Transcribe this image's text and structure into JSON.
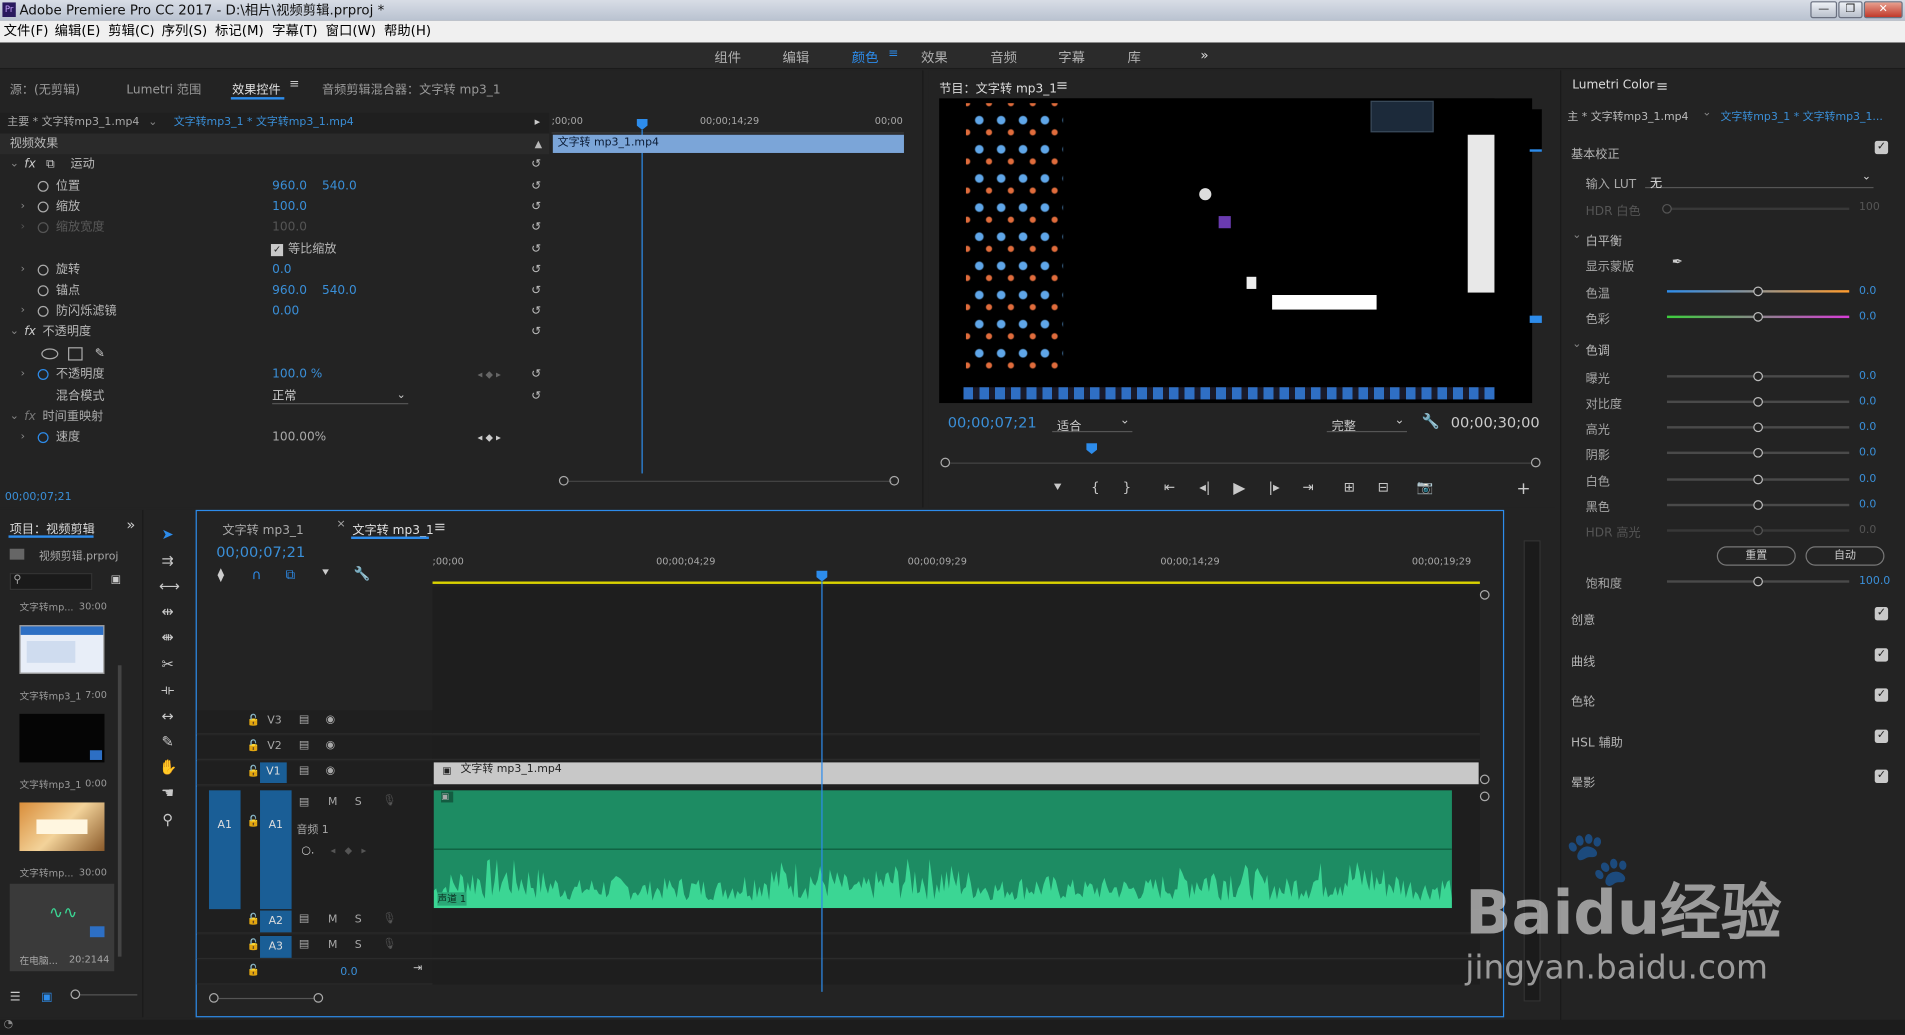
{
  "app": {
    "title": "Adobe Premiere Pro CC 2017 - D:\\相片\\视频剪辑.prproj *",
    "logo": "Pr"
  },
  "window_buttons": {
    "minimize": "—",
    "restore": "❐",
    "close": "✕"
  },
  "menu": [
    "文件(F)",
    "编辑(E)",
    "剪辑(C)",
    "序列(S)",
    "标记(M)",
    "字幕(T)",
    "窗口(W)",
    "帮助(H)"
  ],
  "workspaces": {
    "items": [
      "组件",
      "编辑",
      "颜色",
      "效果",
      "音频",
      "字幕",
      "库"
    ],
    "active": "颜色",
    "more": "»"
  },
  "source_panel": {
    "tabs": [
      "源：(无剪辑)",
      "Lumetri 范围",
      "效果控件",
      "音频剪辑混合器：文字转 mp3_1"
    ],
    "active_tab": "效果控件",
    "master_clip": "主要 * 文字转mp3_1.mp4",
    "sequence_clip": "文字转mp3_1 * 文字转mp3_1.mp4",
    "ruler": {
      "start": ";00;00",
      "mid": "00;00;14;29",
      "end": "00;00"
    },
    "clip_bar": "文字转 mp3_1.mp4",
    "video_effects": "视频效果",
    "motion": "运动",
    "position": {
      "label": "位置",
      "x": "960.0",
      "y": "540.0"
    },
    "scale": {
      "label": "缩放",
      "value": "100.0"
    },
    "scale_width": {
      "label": "缩放宽度",
      "value": "100.0"
    },
    "uniform": {
      "label": "等比缩放",
      "checked": true
    },
    "rotation": {
      "label": "旋转",
      "value": "0.0"
    },
    "anchor": {
      "label": "锚点",
      "x": "960.0",
      "y": "540.0"
    },
    "antiflicker": {
      "label": "防闪烁滤镜",
      "value": "0.00"
    },
    "opacity_group": "不透明度",
    "opacity": {
      "label": "不透明度",
      "value": "100.0 %"
    },
    "blend": {
      "label": "混合模式",
      "value": "正常"
    },
    "time_remap": "时间重映射",
    "speed": {
      "label": "速度",
      "value": "100.00%"
    },
    "timecode": "00;00;07;21"
  },
  "program": {
    "tab": "节目：文字转 mp3_1",
    "timecode": "00;00;07;21",
    "fit": "适合",
    "quality": "完整",
    "duration": "00;00;30;00"
  },
  "lumetri": {
    "tab": "Lumetri Color",
    "master": "主 * 文字转mp3_1.mp4",
    "clip": "文字转mp3_1 * 文字转mp3_1...",
    "basic": "基本校正",
    "input_lut": "输入 LUT",
    "lut_value": "无",
    "hdr_white": {
      "label": "HDR 白色",
      "value": "100"
    },
    "wb": "白平衡",
    "eyedrop": "显示蒙版",
    "temp": {
      "label": "色温",
      "value": "0.0"
    },
    "tint": {
      "label": "色彩",
      "value": "0.0"
    },
    "tone": "色调",
    "tones": [
      {
        "label": "曝光",
        "value": "0.0"
      },
      {
        "label": "对比度",
        "value": "0.0"
      },
      {
        "label": "高光",
        "value": "0.0"
      },
      {
        "label": "阴影",
        "value": "0.0"
      },
      {
        "label": "白色",
        "value": "0.0"
      },
      {
        "label": "黑色",
        "value": "0.0"
      },
      {
        "label": "HDR 高光",
        "value": "0.0"
      }
    ],
    "reset": "重置",
    "auto": "自动",
    "saturation": {
      "label": "饱和度",
      "value": "100.0"
    },
    "sections": [
      "创意",
      "曲线",
      "色轮",
      "HSL 辅助",
      "晕影"
    ]
  },
  "project": {
    "tab": "项目：视频剪辑",
    "file": "视频剪辑.prproj",
    "items": [
      {
        "name": "文字转mp...",
        "dur": "30:00"
      },
      {
        "name": "文字转mp3_1",
        "dur": "7:00"
      },
      {
        "name": "文字转mp3_1",
        "dur": "0:00"
      },
      {
        "name": "文字转mp...",
        "dur": "30:00"
      },
      {
        "name": "在电脑...",
        "dur": "20:2144"
      }
    ]
  },
  "timeline": {
    "tabs": [
      "文字转 mp3_1",
      "文字转 mp3_1"
    ],
    "active": "文字转 mp3_1",
    "timecode": "00;00;07;21",
    "ruler": [
      ";00;00",
      "00;00;04;29",
      "00;00;09;29",
      "00;00;14;29",
      "00;00;19;29"
    ],
    "video_tracks": [
      "V3",
      "V2",
      "V1"
    ],
    "audio_tracks": [
      "A1",
      "A2",
      "A3"
    ],
    "src_audio": "A1",
    "audio1_name": "音频 1",
    "mute": "M",
    "solo": "S",
    "video_clip": "文字转 mp3_1.mp4",
    "audio_label": "声道 1",
    "master_value": "0.0"
  },
  "watermark": {
    "brand": "Baidu经验",
    "url": "jingyan.baidu.com"
  },
  "colors": {
    "accent": "#2d8ceb",
    "audio_clip": "#1d8c63",
    "waveform": "#3bd694",
    "video_clip": "#c8c8c8",
    "timeline_yellow": "#d9d200"
  }
}
